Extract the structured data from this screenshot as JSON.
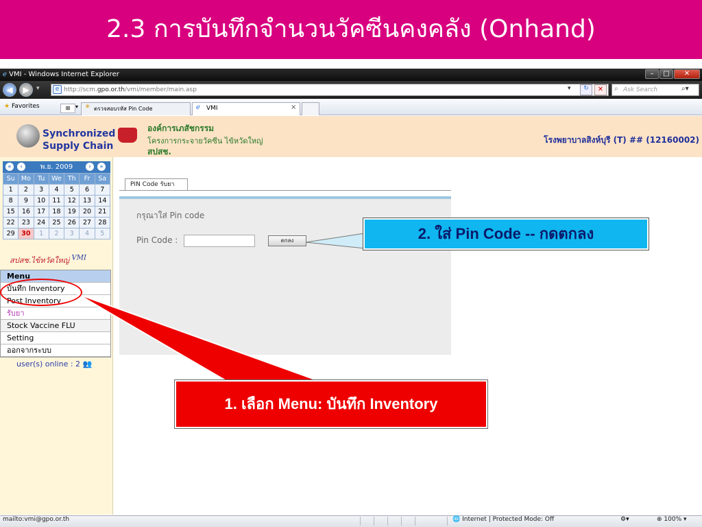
{
  "slide": {
    "title": "2.3 การบันทึกจำนวนวัคซีนคงคลัง (Onhand)"
  },
  "browser": {
    "window_title": "VMI - Windows Internet Explorer",
    "address_url_prefix": "http://scm.",
    "address_url_host": "gpo.or.th",
    "address_url_path": "/vmi/member/main.asp",
    "search_placeholder": "Ask Search",
    "favorites_label": "Favorites",
    "tabs": [
      {
        "label": "ตรวจสอบรหัส Pin Code",
        "active": false
      },
      {
        "label": "VMI",
        "active": true
      }
    ],
    "tab_close": "×",
    "status_left": "mailto:vmi@gpo.or.th",
    "status_zone": "Internet | Protected Mode: Off",
    "status_zoom": "100%"
  },
  "site": {
    "logo_line1": "Synchronized",
    "logo_line2": "Supply Chain",
    "org_line1": "องค์การเภสัชกรรม",
    "org_line2": "โครงการกระจายวัคซีน ไข้หวัดใหญ่",
    "org_line3": "สปสช.",
    "hospital": "โรงพยาบาลสิงห์บุรี (T) ## (12160002)"
  },
  "calendar": {
    "month_label": "พ.ย. 2009",
    "weekdays": [
      "Su",
      "Mo",
      "Tu",
      "We",
      "Th",
      "Fr",
      "Sa"
    ],
    "weeks": [
      [
        "1",
        "2",
        "3",
        "4",
        "5",
        "6",
        "7"
      ],
      [
        "8",
        "9",
        "10",
        "11",
        "12",
        "13",
        "14"
      ],
      [
        "15",
        "16",
        "17",
        "18",
        "19",
        "20",
        "21"
      ],
      [
        "22",
        "23",
        "24",
        "25",
        "26",
        "27",
        "28"
      ],
      [
        "29",
        "30",
        "1",
        "2",
        "3",
        "4",
        "5"
      ]
    ],
    "today": "30",
    "caption": "สปสช.ไข้หวัดใหญ่",
    "caption_logo": "VMI"
  },
  "menu": {
    "header": "Menu",
    "items": [
      {
        "label": "บันทึก Inventory"
      },
      {
        "label": "Post Inventory"
      },
      {
        "label": "รับยา"
      },
      {
        "label": "Stock Vaccine FLU"
      },
      {
        "label": "Setting"
      },
      {
        "label": "ออกจากระบบ"
      }
    ],
    "users_online": "user(s) online : 2"
  },
  "content": {
    "tab_label": "PIN Code รับยา",
    "heading": "กรุณาใส่ Pin code",
    "pin_label": "Pin Code :",
    "pin_value": "",
    "ok_label": "ตกลง"
  },
  "callouts": {
    "step2": "2. ใส่ Pin Code -- กดตกลง",
    "step1": "1. เลือก Menu: บันทึก Inventory"
  },
  "colors": {
    "slide_header": "#d8007f",
    "callout_red": "#ee0000",
    "callout_blue": "#0fb6ef"
  }
}
